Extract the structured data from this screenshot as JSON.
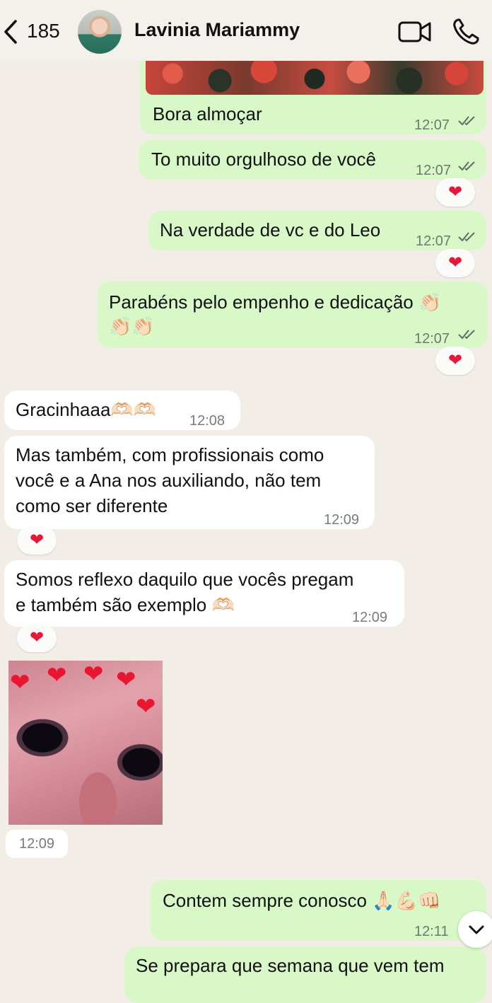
{
  "header": {
    "unread_count": "185",
    "contact_name": "Lavinia Mariammy",
    "icons": [
      "back-chevron-icon",
      "avatar",
      "video-call-icon",
      "phone-call-icon"
    ]
  },
  "messages": [
    {
      "dir": "out",
      "text": "Bora almoçar",
      "time": "12:07",
      "status": "read"
    },
    {
      "dir": "out",
      "text": "To muito orgulhoso de você",
      "time": "12:07",
      "status": "read",
      "reaction": "❤"
    },
    {
      "dir": "out",
      "text": "Na verdade de vc e do Leo",
      "time": "12:07",
      "status": "read",
      "reaction": "❤"
    },
    {
      "dir": "out",
      "text_line1": "Parabéns pelo empenho e dedicação 👏🏻",
      "text_line2": "👏🏻👏🏻",
      "time": "12:07",
      "status": "read",
      "reaction": "❤"
    },
    {
      "dir": "in",
      "text": "Gracinhaaa🫶🏻🫶🏻",
      "time": "12:08"
    },
    {
      "dir": "in",
      "lines": [
        "Mas também, com profissionais como",
        "você e a Ana nos auxiliando, não tem",
        "como ser diferente"
      ],
      "time": "12:09",
      "reaction": "❤"
    },
    {
      "dir": "in",
      "lines": [
        "Somos reflexo daquilo que vocês pregam",
        "e também são exemplo 🫶🏻"
      ],
      "time": "12:09",
      "reaction": "❤"
    },
    {
      "dir": "in",
      "type": "sticker",
      "sticker": "kitten-with-hearts",
      "time": "12:09"
    },
    {
      "dir": "out",
      "text": "Contem sempre conosco 🙏🏻💪🏻👊🏻",
      "time": "12:11"
    },
    {
      "dir": "out",
      "text": "Se prepara que semana que vem tem"
    }
  ],
  "colors": {
    "background": "#f2eee7",
    "outgoing_bubble": "#d9f8c8",
    "incoming_bubble": "#ffffff",
    "reaction_heart": "#e3183a"
  },
  "controls": {
    "scroll_down_icon": "chevron-down-icon"
  }
}
